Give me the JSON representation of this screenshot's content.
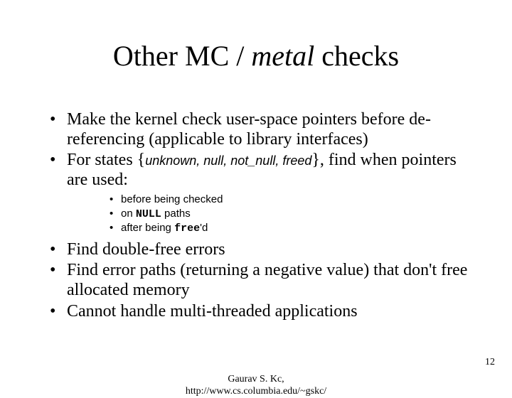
{
  "title": {
    "pre": "Other MC / ",
    "ital": "metal",
    "post": " checks"
  },
  "bullets": {
    "b1": "Make the kernel check user-space pointers before de-referencing (applicable to library interfaces)",
    "b2_pre": "For states {",
    "b2_states": "unknown, null, not_null, freed",
    "b2_post": "}, find when pointers are used:",
    "sub": {
      "s1": "before being checked",
      "s2_pre": "on ",
      "s2_code": "NULL",
      "s2_post": " paths",
      "s3_pre": "after being ",
      "s3_code": "free",
      "s3_post": "'d"
    },
    "b3": "Find double-free errors",
    "b4": "Find error paths (returning a negative value) that don't free allocated memory",
    "b5": "Cannot handle multi-threaded applications"
  },
  "footer": {
    "author": "Gaurav S. Kc,",
    "url": "http://www.cs.columbia.edu/~gskc/",
    "page": "12"
  }
}
